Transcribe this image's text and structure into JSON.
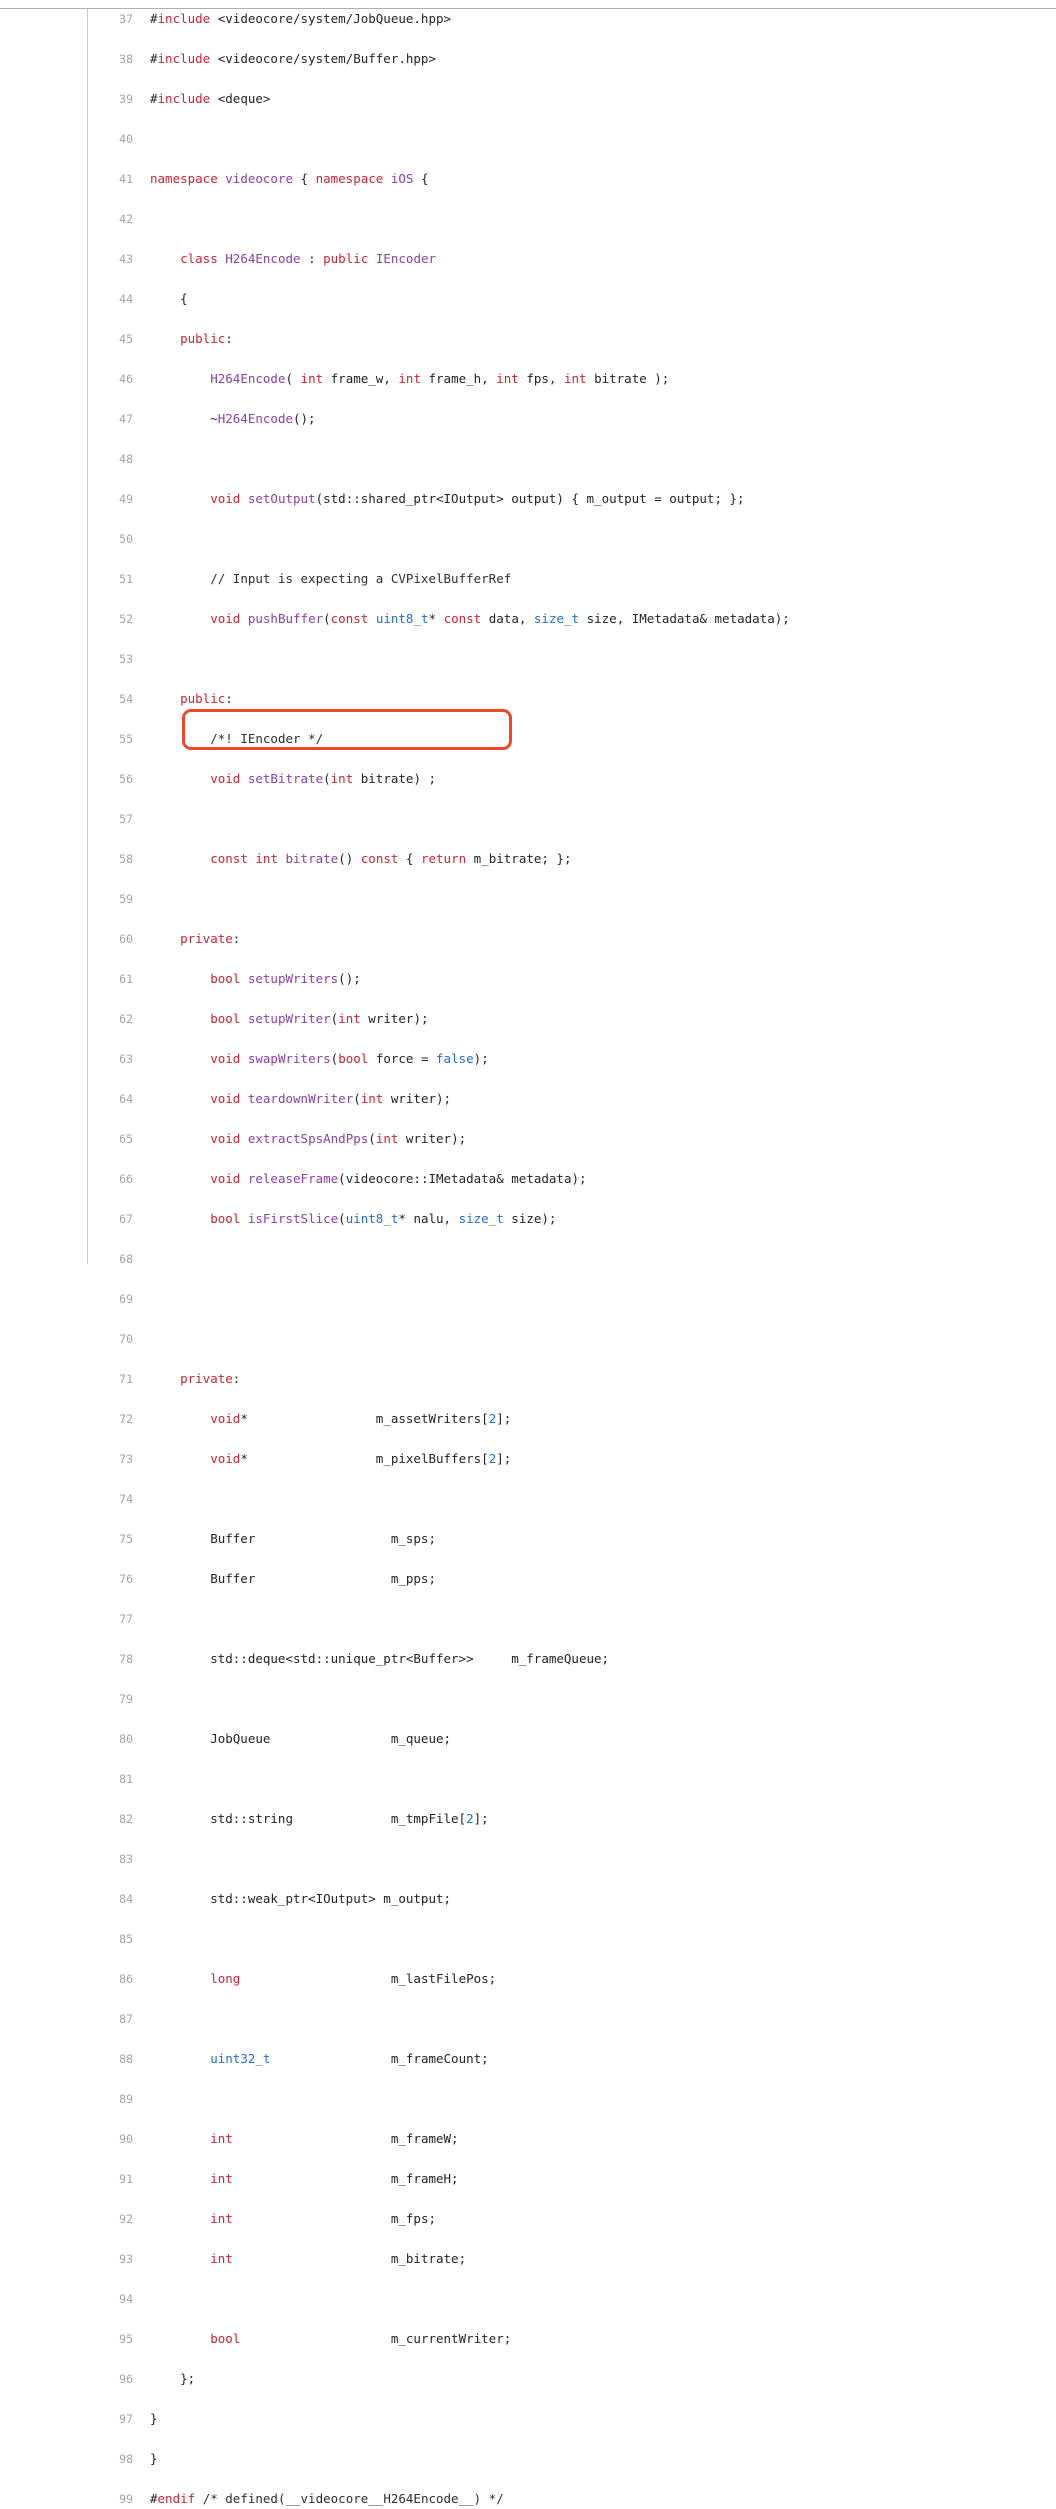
{
  "viewer": {
    "first_line": 37,
    "last_line": 99,
    "line_height": 20,
    "gutter_divider": true,
    "top_rule": true
  },
  "colors": {
    "background": "#ffffff",
    "text": "#20252b",
    "line_number": "#a0a4a8",
    "keyword": "#d02334",
    "function": "#8b3fa8",
    "type": "#1f6fd0",
    "number": "#1f6fd0",
    "comment": "#2b2f33",
    "annotation_border": "#f0472a",
    "rule": "#b0b0b0"
  },
  "annotation": {
    "shape": "rounded-rectangle",
    "color": "#f0472a",
    "covers_lines": [
      72,
      73
    ],
    "label": "highlight-box"
  },
  "lines": [
    {
      "n": 37,
      "tokens": [
        {
          "t": "#",
          "c": "pp"
        },
        {
          "t": "include",
          "c": "ppk"
        },
        {
          "t": " <videocore/system/JobQueue.hpp>",
          "c": "pl"
        }
      ]
    },
    {
      "n": 38,
      "tokens": [
        {
          "t": "#",
          "c": "pp"
        },
        {
          "t": "include",
          "c": "ppk"
        },
        {
          "t": " <videocore/system/Buffer.hpp>",
          "c": "pl"
        }
      ]
    },
    {
      "n": 39,
      "tokens": [
        {
          "t": "#",
          "c": "pp"
        },
        {
          "t": "include",
          "c": "ppk"
        },
        {
          "t": " <deque>",
          "c": "pl"
        }
      ]
    },
    {
      "n": 40,
      "tokens": []
    },
    {
      "n": 41,
      "tokens": [
        {
          "t": "namespace",
          "c": "k"
        },
        {
          "t": " ",
          "c": "pl"
        },
        {
          "t": "videocore",
          "c": "fn"
        },
        {
          "t": " { ",
          "c": "pl"
        },
        {
          "t": "namespace",
          "c": "k"
        },
        {
          "t": " ",
          "c": "pl"
        },
        {
          "t": "iOS",
          "c": "fn"
        },
        {
          "t": " {",
          "c": "pl"
        }
      ]
    },
    {
      "n": 42,
      "tokens": []
    },
    {
      "n": 43,
      "tokens": [
        {
          "t": "    ",
          "c": "pl"
        },
        {
          "t": "class",
          "c": "k"
        },
        {
          "t": " ",
          "c": "pl"
        },
        {
          "t": "H264Encode",
          "c": "fn"
        },
        {
          "t": " : ",
          "c": "pl"
        },
        {
          "t": "public",
          "c": "k"
        },
        {
          "t": " ",
          "c": "pl"
        },
        {
          "t": "IEncoder",
          "c": "fn"
        }
      ]
    },
    {
      "n": 44,
      "tokens": [
        {
          "t": "    {",
          "c": "pl"
        }
      ]
    },
    {
      "n": 45,
      "tokens": [
        {
          "t": "    ",
          "c": "pl"
        },
        {
          "t": "public",
          "c": "k"
        },
        {
          "t": ":",
          "c": "pl"
        }
      ]
    },
    {
      "n": 46,
      "tokens": [
        {
          "t": "        ",
          "c": "pl"
        },
        {
          "t": "H264Encode",
          "c": "fn"
        },
        {
          "t": "( ",
          "c": "pl"
        },
        {
          "t": "int",
          "c": "k"
        },
        {
          "t": " frame_w, ",
          "c": "pl"
        },
        {
          "t": "int",
          "c": "k"
        },
        {
          "t": " frame_h, ",
          "c": "pl"
        },
        {
          "t": "int",
          "c": "k"
        },
        {
          "t": " fps, ",
          "c": "pl"
        },
        {
          "t": "int",
          "c": "k"
        },
        {
          "t": " bitrate );",
          "c": "pl"
        }
      ]
    },
    {
      "n": 47,
      "tokens": [
        {
          "t": "        ~",
          "c": "pl"
        },
        {
          "t": "H264Encode",
          "c": "fn"
        },
        {
          "t": "();",
          "c": "pl"
        }
      ]
    },
    {
      "n": 48,
      "tokens": []
    },
    {
      "n": 49,
      "tokens": [
        {
          "t": "        ",
          "c": "pl"
        },
        {
          "t": "void",
          "c": "k"
        },
        {
          "t": " ",
          "c": "pl"
        },
        {
          "t": "setOutput",
          "c": "fn"
        },
        {
          "t": "(std::shared_ptr<IOutput> output) { m_output = output; };",
          "c": "pl"
        }
      ]
    },
    {
      "n": 50,
      "tokens": []
    },
    {
      "n": 51,
      "tokens": [
        {
          "t": "        ",
          "c": "pl"
        },
        {
          "t": "// Input is expecting a CVPixelBufferRef",
          "c": "cm"
        }
      ]
    },
    {
      "n": 52,
      "tokens": [
        {
          "t": "        ",
          "c": "pl"
        },
        {
          "t": "void",
          "c": "k"
        },
        {
          "t": " ",
          "c": "pl"
        },
        {
          "t": "pushBuffer",
          "c": "fn"
        },
        {
          "t": "(",
          "c": "pl"
        },
        {
          "t": "const",
          "c": "k"
        },
        {
          "t": " ",
          "c": "pl"
        },
        {
          "t": "uint8_t",
          "c": "ty"
        },
        {
          "t": "* ",
          "c": "pl"
        },
        {
          "t": "const",
          "c": "k"
        },
        {
          "t": " data, ",
          "c": "pl"
        },
        {
          "t": "size_t",
          "c": "ty"
        },
        {
          "t": " size, IMetadata& metadata);",
          "c": "pl"
        }
      ]
    },
    {
      "n": 53,
      "tokens": []
    },
    {
      "n": 54,
      "tokens": [
        {
          "t": "    ",
          "c": "pl"
        },
        {
          "t": "public",
          "c": "k"
        },
        {
          "t": ":",
          "c": "pl"
        }
      ]
    },
    {
      "n": 55,
      "tokens": [
        {
          "t": "        ",
          "c": "pl"
        },
        {
          "t": "/*! IEncoder */",
          "c": "cm"
        }
      ]
    },
    {
      "n": 56,
      "tokens": [
        {
          "t": "        ",
          "c": "pl"
        },
        {
          "t": "void",
          "c": "k"
        },
        {
          "t": " ",
          "c": "pl"
        },
        {
          "t": "setBitrate",
          "c": "fn"
        },
        {
          "t": "(",
          "c": "pl"
        },
        {
          "t": "int",
          "c": "k"
        },
        {
          "t": " bitrate) ;",
          "c": "pl"
        }
      ]
    },
    {
      "n": 57,
      "tokens": []
    },
    {
      "n": 58,
      "tokens": [
        {
          "t": "        ",
          "c": "pl"
        },
        {
          "t": "const",
          "c": "k"
        },
        {
          "t": " ",
          "c": "pl"
        },
        {
          "t": "int",
          "c": "k"
        },
        {
          "t": " ",
          "c": "pl"
        },
        {
          "t": "bitrate",
          "c": "fn"
        },
        {
          "t": "() ",
          "c": "pl"
        },
        {
          "t": "const",
          "c": "k"
        },
        {
          "t": " { ",
          "c": "pl"
        },
        {
          "t": "return",
          "c": "k"
        },
        {
          "t": " m_bitrate; };",
          "c": "pl"
        }
      ]
    },
    {
      "n": 59,
      "tokens": []
    },
    {
      "n": 60,
      "tokens": [
        {
          "t": "    ",
          "c": "pl"
        },
        {
          "t": "private",
          "c": "k"
        },
        {
          "t": ":",
          "c": "pl"
        }
      ]
    },
    {
      "n": 61,
      "tokens": [
        {
          "t": "        ",
          "c": "pl"
        },
        {
          "t": "bool",
          "c": "k"
        },
        {
          "t": " ",
          "c": "pl"
        },
        {
          "t": "setupWriters",
          "c": "fn"
        },
        {
          "t": "();",
          "c": "pl"
        }
      ]
    },
    {
      "n": 62,
      "tokens": [
        {
          "t": "        ",
          "c": "pl"
        },
        {
          "t": "bool",
          "c": "k"
        },
        {
          "t": " ",
          "c": "pl"
        },
        {
          "t": "setupWriter",
          "c": "fn"
        },
        {
          "t": "(",
          "c": "pl"
        },
        {
          "t": "int",
          "c": "k"
        },
        {
          "t": " writer);",
          "c": "pl"
        }
      ]
    },
    {
      "n": 63,
      "tokens": [
        {
          "t": "        ",
          "c": "pl"
        },
        {
          "t": "void",
          "c": "k"
        },
        {
          "t": " ",
          "c": "pl"
        },
        {
          "t": "swapWriters",
          "c": "fn"
        },
        {
          "t": "(",
          "c": "pl"
        },
        {
          "t": "bool",
          "c": "k"
        },
        {
          "t": " force = ",
          "c": "pl"
        },
        {
          "t": "false",
          "c": "ty"
        },
        {
          "t": ");",
          "c": "pl"
        }
      ]
    },
    {
      "n": 64,
      "tokens": [
        {
          "t": "        ",
          "c": "pl"
        },
        {
          "t": "void",
          "c": "k"
        },
        {
          "t": " ",
          "c": "pl"
        },
        {
          "t": "teardownWriter",
          "c": "fn"
        },
        {
          "t": "(",
          "c": "pl"
        },
        {
          "t": "int",
          "c": "k"
        },
        {
          "t": " writer);",
          "c": "pl"
        }
      ]
    },
    {
      "n": 65,
      "tokens": [
        {
          "t": "        ",
          "c": "pl"
        },
        {
          "t": "void",
          "c": "k"
        },
        {
          "t": " ",
          "c": "pl"
        },
        {
          "t": "extractSpsAndPps",
          "c": "fn"
        },
        {
          "t": "(",
          "c": "pl"
        },
        {
          "t": "int",
          "c": "k"
        },
        {
          "t": " writer);",
          "c": "pl"
        }
      ]
    },
    {
      "n": 66,
      "tokens": [
        {
          "t": "        ",
          "c": "pl"
        },
        {
          "t": "void",
          "c": "k"
        },
        {
          "t": " ",
          "c": "pl"
        },
        {
          "t": "releaseFrame",
          "c": "fn"
        },
        {
          "t": "(videocore::IMetadata& metadata);",
          "c": "pl"
        }
      ]
    },
    {
      "n": 67,
      "tokens": [
        {
          "t": "        ",
          "c": "pl"
        },
        {
          "t": "bool",
          "c": "k"
        },
        {
          "t": " ",
          "c": "pl"
        },
        {
          "t": "isFirstSlice",
          "c": "fn"
        },
        {
          "t": "(",
          "c": "pl"
        },
        {
          "t": "uint8_t",
          "c": "ty"
        },
        {
          "t": "* nalu, ",
          "c": "pl"
        },
        {
          "t": "size_t",
          "c": "ty"
        },
        {
          "t": " size);",
          "c": "pl"
        }
      ]
    },
    {
      "n": 68,
      "tokens": []
    },
    {
      "n": 69,
      "tokens": []
    },
    {
      "n": 70,
      "tokens": []
    },
    {
      "n": 71,
      "tokens": [
        {
          "t": "    ",
          "c": "pl"
        },
        {
          "t": "private",
          "c": "k"
        },
        {
          "t": ":",
          "c": "pl"
        }
      ]
    },
    {
      "n": 72,
      "tokens": [
        {
          "t": "        ",
          "c": "pl"
        },
        {
          "t": "void",
          "c": "k"
        },
        {
          "t": "*                 m_assetWriters[",
          "c": "pl"
        },
        {
          "t": "2",
          "c": "num"
        },
        {
          "t": "];",
          "c": "pl"
        }
      ]
    },
    {
      "n": 73,
      "tokens": [
        {
          "t": "        ",
          "c": "pl"
        },
        {
          "t": "void",
          "c": "k"
        },
        {
          "t": "*                 m_pixelBuffers[",
          "c": "pl"
        },
        {
          "t": "2",
          "c": "num"
        },
        {
          "t": "];",
          "c": "pl"
        }
      ]
    },
    {
      "n": 74,
      "tokens": []
    },
    {
      "n": 75,
      "tokens": [
        {
          "t": "        Buffer                  m_sps;",
          "c": "pl"
        }
      ]
    },
    {
      "n": 76,
      "tokens": [
        {
          "t": "        Buffer                  m_pps;",
          "c": "pl"
        }
      ]
    },
    {
      "n": 77,
      "tokens": []
    },
    {
      "n": 78,
      "tokens": [
        {
          "t": "        std::deque<std::unique_ptr<Buffer>>     m_frameQueue;",
          "c": "pl"
        }
      ]
    },
    {
      "n": 79,
      "tokens": []
    },
    {
      "n": 80,
      "tokens": [
        {
          "t": "        JobQueue                m_queue;",
          "c": "pl"
        }
      ]
    },
    {
      "n": 81,
      "tokens": []
    },
    {
      "n": 82,
      "tokens": [
        {
          "t": "        std::string             m_tmpFile[",
          "c": "pl"
        },
        {
          "t": "2",
          "c": "num"
        },
        {
          "t": "];",
          "c": "pl"
        }
      ]
    },
    {
      "n": 83,
      "tokens": []
    },
    {
      "n": 84,
      "tokens": [
        {
          "t": "        std::weak_ptr<IOutput> m_output;",
          "c": "pl"
        }
      ]
    },
    {
      "n": 85,
      "tokens": []
    },
    {
      "n": 86,
      "tokens": [
        {
          "t": "        ",
          "c": "pl"
        },
        {
          "t": "long",
          "c": "k"
        },
        {
          "t": "                    m_lastFilePos;",
          "c": "pl"
        }
      ]
    },
    {
      "n": 87,
      "tokens": []
    },
    {
      "n": 88,
      "tokens": [
        {
          "t": "        ",
          "c": "pl"
        },
        {
          "t": "uint32_t",
          "c": "ty"
        },
        {
          "t": "                m_frameCount;",
          "c": "pl"
        }
      ]
    },
    {
      "n": 89,
      "tokens": []
    },
    {
      "n": 90,
      "tokens": [
        {
          "t": "        ",
          "c": "pl"
        },
        {
          "t": "int",
          "c": "k"
        },
        {
          "t": "                     m_frameW;",
          "c": "pl"
        }
      ]
    },
    {
      "n": 91,
      "tokens": [
        {
          "t": "        ",
          "c": "pl"
        },
        {
          "t": "int",
          "c": "k"
        },
        {
          "t": "                     m_frameH;",
          "c": "pl"
        }
      ]
    },
    {
      "n": 92,
      "tokens": [
        {
          "t": "        ",
          "c": "pl"
        },
        {
          "t": "int",
          "c": "k"
        },
        {
          "t": "                     m_fps;",
          "c": "pl"
        }
      ]
    },
    {
      "n": 93,
      "tokens": [
        {
          "t": "        ",
          "c": "pl"
        },
        {
          "t": "int",
          "c": "k"
        },
        {
          "t": "                     m_bitrate;",
          "c": "pl"
        }
      ]
    },
    {
      "n": 94,
      "tokens": []
    },
    {
      "n": 95,
      "tokens": [
        {
          "t": "        ",
          "c": "pl"
        },
        {
          "t": "bool",
          "c": "k"
        },
        {
          "t": "                    m_currentWriter;",
          "c": "pl"
        }
      ]
    },
    {
      "n": 96,
      "tokens": [
        {
          "t": "    };",
          "c": "pl"
        }
      ]
    },
    {
      "n": 97,
      "tokens": [
        {
          "t": "}",
          "c": "pl"
        }
      ]
    },
    {
      "n": 98,
      "tokens": [
        {
          "t": "}",
          "c": "pl"
        }
      ]
    },
    {
      "n": 99,
      "tokens": [
        {
          "t": "#",
          "c": "pp"
        },
        {
          "t": "endif",
          "c": "ppk"
        },
        {
          "t": " ",
          "c": "pl"
        },
        {
          "t": "/* defined(__videocore__H264Encode__) */",
          "c": "cm"
        }
      ]
    }
  ]
}
